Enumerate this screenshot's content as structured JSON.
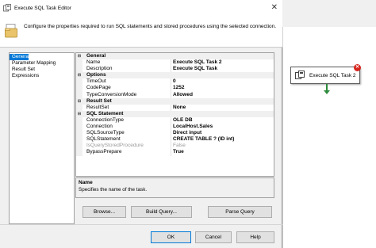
{
  "window": {
    "title": "Execute SQL Task Editor",
    "close_glyph": "✕"
  },
  "header": {
    "description": "Configure the properties required to run SQL statements and stored procedures using the selected connection.",
    "icon": "task-folder-icon"
  },
  "nav": {
    "items": [
      {
        "label": "General",
        "selected": true
      },
      {
        "label": "Parameter Mapping",
        "selected": false
      },
      {
        "label": "Result Set",
        "selected": false
      },
      {
        "label": "Expressions",
        "selected": false
      }
    ]
  },
  "grid": {
    "sections": [
      {
        "title": "General",
        "toggle": "⊟",
        "rows": [
          {
            "name": "Name",
            "value": "Execute SQL Task 2"
          },
          {
            "name": "Description",
            "value": "Execute SQL Task"
          }
        ]
      },
      {
        "title": "Options",
        "toggle": "⊟",
        "rows": [
          {
            "name": "TimeOut",
            "value": "0"
          },
          {
            "name": "CodePage",
            "value": "1252"
          },
          {
            "name": "TypeConversionMode",
            "value": "Allowed"
          }
        ]
      },
      {
        "title": "Result Set",
        "toggle": "⊟",
        "rows": [
          {
            "name": "ResultSet",
            "value": "None"
          }
        ]
      },
      {
        "title": "SQL Statement",
        "toggle": "⊟",
        "rows": [
          {
            "name": "ConnectionType",
            "value": "OLE DB"
          },
          {
            "name": "Connection",
            "value": "LocalHost.Sales"
          },
          {
            "name": "SQLSourceType",
            "value": "Direct input"
          },
          {
            "name": "SQLStatement",
            "value": "CREATE TABLE ? (ID int)"
          },
          {
            "name": "IsQueryStoredProcedure",
            "value": "False",
            "disabled": true
          },
          {
            "name": "BypassPrepare",
            "value": "True"
          }
        ]
      }
    ]
  },
  "description_panel": {
    "title": "Name",
    "text": "Specifies the name of the task."
  },
  "buttons": {
    "browse": "Browse...",
    "build_query": "Build Query...",
    "parse_query": "Parse Query",
    "ok": "OK",
    "cancel": "Cancel",
    "help": "Help"
  },
  "designer": {
    "task_label": "Execute SQL Task 2",
    "error_glyph": "✕"
  },
  "colors": {
    "selection": "#0078d7",
    "error": "#d7261e",
    "connector": "#2e8b3d"
  }
}
